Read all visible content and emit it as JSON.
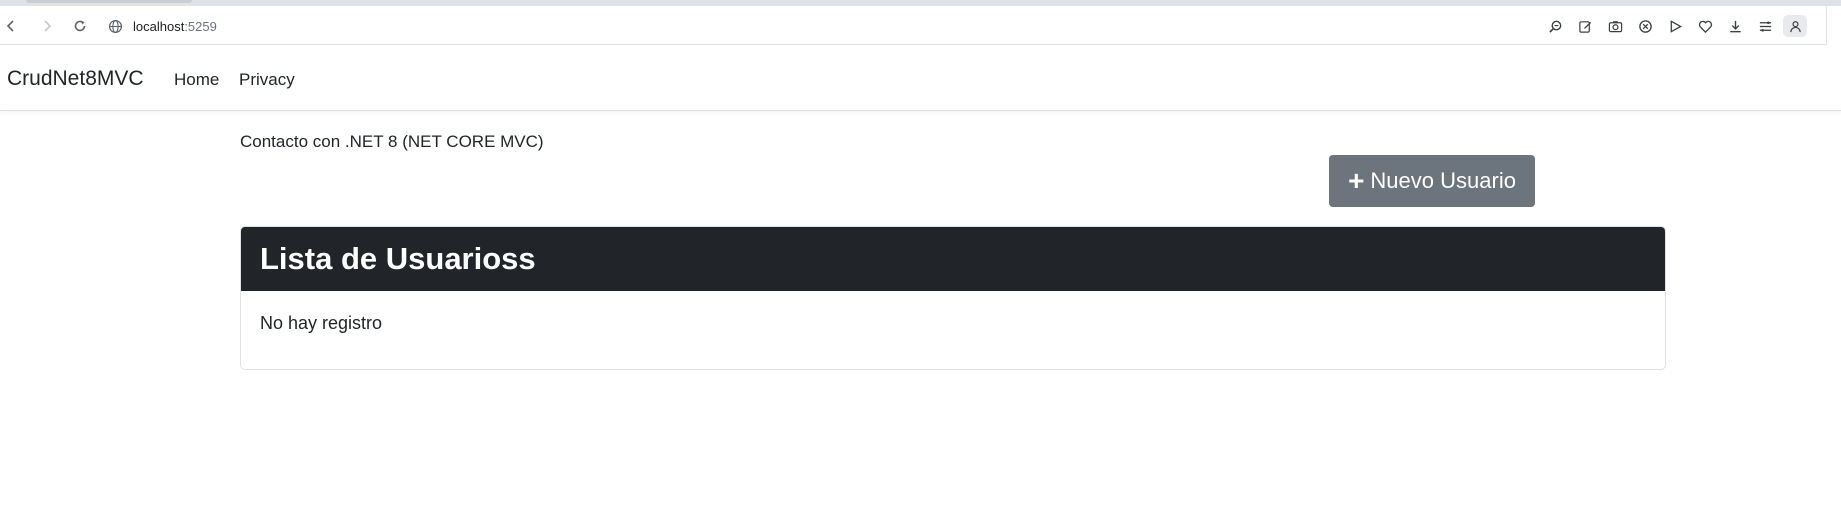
{
  "browser": {
    "url_host": "localhost",
    "url_port": ":5259",
    "icons": [
      "back-icon",
      "forward-icon",
      "reload-icon",
      "site-info-icon",
      "zoom-icon",
      "edit-icon",
      "camera-icon",
      "block-icon",
      "play-icon",
      "heart-icon",
      "download-icon",
      "menu-icon",
      "profile-icon"
    ]
  },
  "navbar": {
    "brand": "CrudNet8MVC",
    "links": [
      "Home",
      "Privacy"
    ]
  },
  "main": {
    "subtitle": "Contacto con .NET 8 (NET CORE MVC)",
    "new_button_label": "Nuevo Usuario",
    "new_button_icon": "plus-icon",
    "card_title": "Lista de Usuarioss",
    "empty_message": "No hay registro"
  },
  "colors": {
    "button_bg": "#6c757d",
    "card_header_bg": "#212529"
  }
}
